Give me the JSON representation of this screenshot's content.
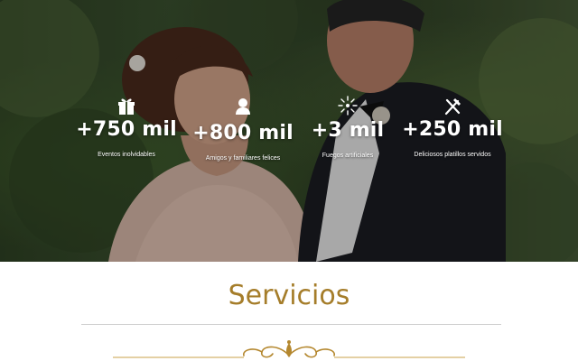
{
  "stats": [
    {
      "icon": "gift-icon",
      "value": "+750 mil",
      "label": "Eventos inolvidables"
    },
    {
      "icon": "user-icon",
      "value": "+800 mil",
      "label": "Amigos y familiares felices"
    },
    {
      "icon": "fireworks-icon",
      "value": "+3 mil",
      "label": "Fuegos artificiales"
    },
    {
      "icon": "cutlery-icon",
      "value": "+250 mil",
      "label": "Deliciosos platillos servidos"
    }
  ],
  "services": {
    "title": "Servicios"
  },
  "colors": {
    "accent": "#a57d2a",
    "divider": "#cfcfcf",
    "stat_text": "#ffffff"
  }
}
